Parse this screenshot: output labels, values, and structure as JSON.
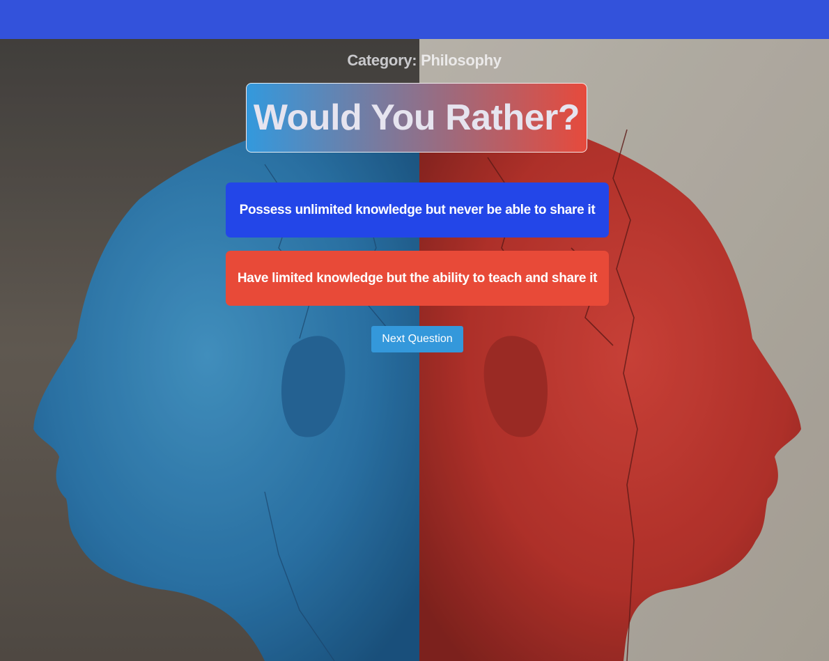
{
  "header": {
    "bar_color": "#3352db"
  },
  "category": {
    "label": "Category:",
    "value": "Philosophy"
  },
  "title": {
    "text": "Would You Rather?",
    "gradient_from": "#3399dd",
    "gradient_to": "#e64a3c"
  },
  "options": [
    {
      "label": "Possess unlimited knowledge but never be able to share it",
      "color": "#2346e8"
    },
    {
      "label": "Have limited knowledge but the ability to teach and share it",
      "color": "#e84a38"
    }
  ],
  "next_button": {
    "label": "Next Question",
    "color": "#3498db"
  },
  "background": {
    "left_color": "#3a86c2",
    "right_color": "#d6403a"
  }
}
